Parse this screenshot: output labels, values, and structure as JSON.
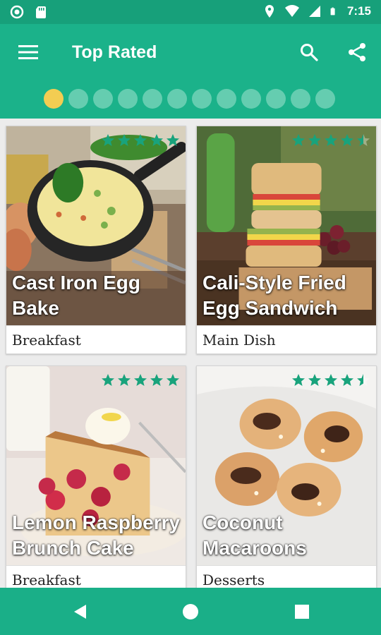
{
  "status_bar": {
    "time": "7:15",
    "left_icons": [
      "record-icon",
      "sd-card-icon"
    ],
    "right_icons": [
      "location-icon",
      "wifi-icon",
      "signal-icon",
      "battery-icon"
    ]
  },
  "app_bar": {
    "title": "Top Rated",
    "menu_icon": "hamburger-menu-icon",
    "search_icon": "search-icon",
    "share_icon": "share-icon",
    "colors": {
      "primary": "#1bb28a",
      "dark": "#17a07a",
      "accent": "#f3cd52"
    }
  },
  "pager": {
    "total": 12,
    "active_index": 0
  },
  "recipes": [
    {
      "title_line1": "Cast Iron Egg",
      "title_line2": "Bake",
      "category": "Breakfast",
      "rating": 5
    },
    {
      "title_line1": "Cali-Style Fried",
      "title_line2": "Egg Sandwich",
      "category": "Main Dish",
      "rating": 4.5
    },
    {
      "title_line1": "Lemon Raspberry",
      "title_line2": "Brunch Cake",
      "category": "Breakfast",
      "rating": 5
    },
    {
      "title_line1": "Coconut",
      "title_line2": "Macaroons",
      "category": "Desserts",
      "rating": 4.5
    }
  ],
  "star_color": "#19a37c",
  "nav_bar": {
    "icons": [
      "back-icon",
      "home-icon",
      "recents-icon"
    ]
  }
}
